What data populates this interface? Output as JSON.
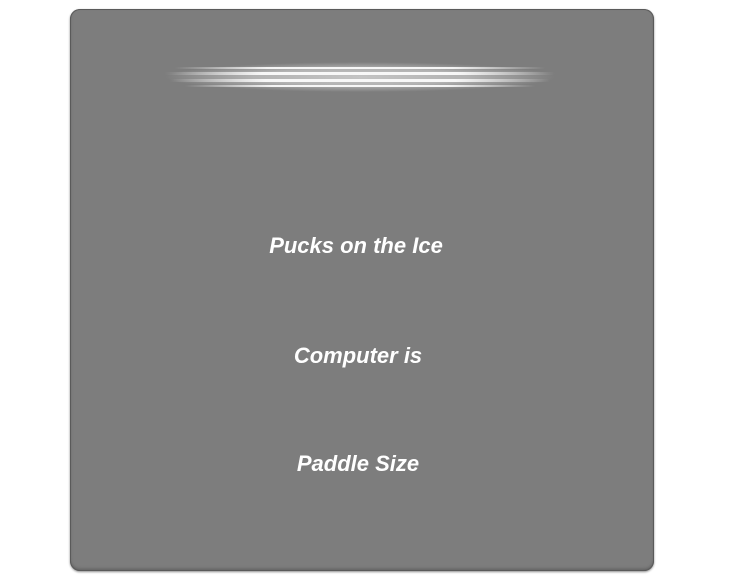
{
  "menu": {
    "items": [
      {
        "label": "Pucks on the Ice"
      },
      {
        "label": "Computer is"
      },
      {
        "label": "Paddle Size"
      }
    ]
  },
  "colors": {
    "panel": "#7d7d7d",
    "text": "#ffffff",
    "glow": "#ffffff"
  }
}
